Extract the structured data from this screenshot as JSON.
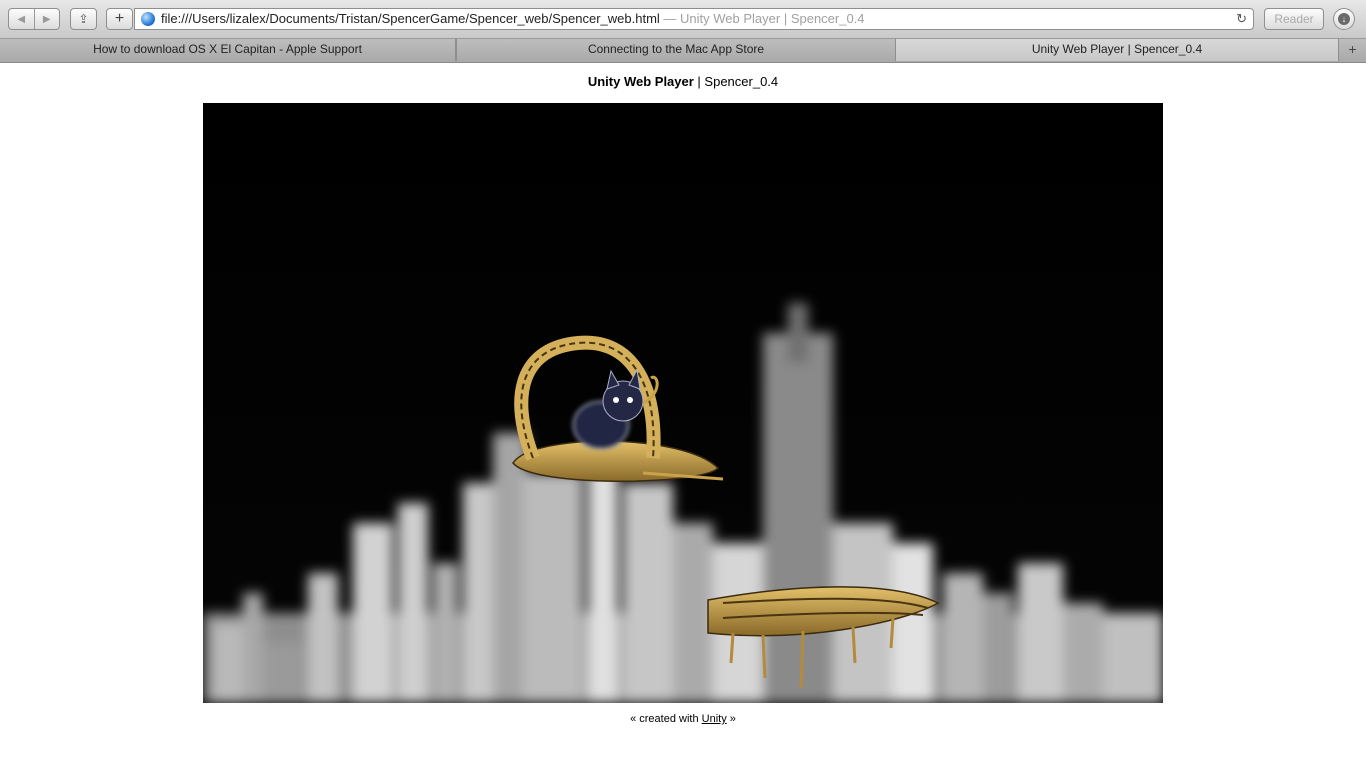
{
  "toolbar": {
    "back_glyph": "◀",
    "forward_glyph": "▶",
    "share_glyph": "⇪",
    "add_glyph": "+",
    "url": "file:///Users/lizalex/Documents/Tristan/SpencerGame/Spencer_web/Spencer_web.html",
    "url_title_suffix": "— Unity Web Player | Spencer_0.4",
    "reload_glyph": "↻",
    "reader_label": "Reader",
    "download_glyph": "↓"
  },
  "tabs": [
    {
      "label": "How to download OS X El Capitan - Apple Support",
      "active": false
    },
    {
      "label": "Connecting to the Mac App Store",
      "active": false
    },
    {
      "label": "Unity Web Player | Spencer_0.4",
      "active": true
    }
  ],
  "newtab_glyph": "+",
  "page": {
    "title_bold": "Unity Web Player",
    "title_sep": " | ",
    "title_rest": "Spencer_0.4",
    "footer_prefix": "« created with ",
    "footer_link": "Unity",
    "footer_suffix": " »"
  },
  "colors": {
    "game_background": "#000000",
    "platform_wood": "#c9a24a",
    "cat": "#1f2238",
    "skyline": "#bdbdbd"
  },
  "game": {
    "scene": [
      "black-sky",
      "blurred-gray-city-skyline",
      "wooden-arch-platform",
      "blue-cat-character",
      "wooden-log-platform"
    ]
  }
}
